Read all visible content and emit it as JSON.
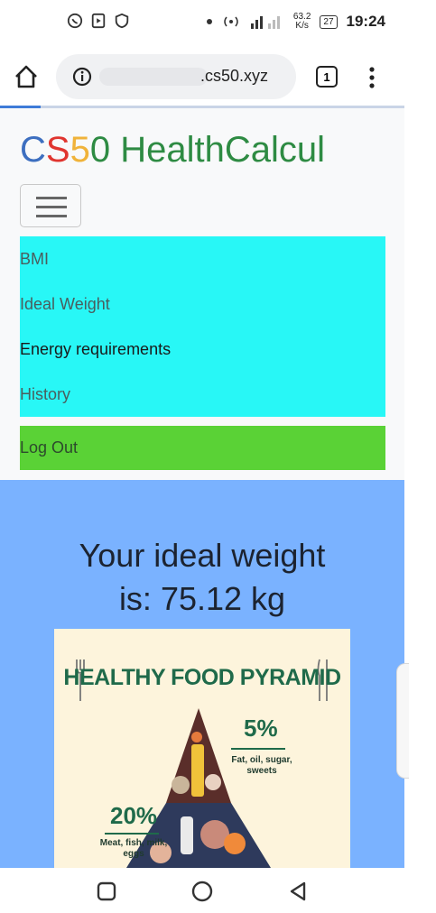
{
  "status_bar": {
    "network_speed_value": "63.2",
    "network_speed_unit": "K/s",
    "battery": "27",
    "clock": "19:24",
    "icons": [
      "whatsapp-icon",
      "media-icon",
      "shield-icon",
      "dot-icon",
      "hotspot-icon",
      "signal-icon",
      "battery-icon"
    ]
  },
  "browser": {
    "url_visible": ".cs50.xyz",
    "tab_count": "1",
    "icons": [
      "home-icon",
      "info-icon",
      "more-vert-icon"
    ]
  },
  "navbar": {
    "brand": {
      "letters": [
        {
          "text": "C",
          "color": "#3d6fc0"
        },
        {
          "text": "S",
          "color": "#e0352f"
        },
        {
          "text": "5",
          "color": "#f0b33a"
        },
        {
          "text": "0",
          "color": "#2e8b43"
        }
      ],
      "rest": " HealthCalcul",
      "rest_color": "#2e8b43"
    },
    "items": [
      {
        "label": "BMI",
        "active": false
      },
      {
        "label": "Ideal Weight",
        "active": false
      },
      {
        "label": "Energy requirements",
        "active": true
      },
      {
        "label": "History",
        "active": false
      }
    ],
    "logout_label": "Log Out",
    "colors": {
      "nav_bg": "#28f7f6",
      "logout_bg": "#5ad236",
      "content_bg": "#7ab2ff"
    }
  },
  "main": {
    "result_line1": "Your ideal weight",
    "result_line2": "is: 75.12 kg",
    "pyramid": {
      "title": "HEALTHY FOOD PYRAMID",
      "tiers": [
        {
          "percent": "5%",
          "label_line1": "Fat, oil, sugar,",
          "label_line2": "sweets"
        },
        {
          "percent": "20%",
          "label_line1": "Meat, fish, milk,",
          "label_line2": "eggs"
        }
      ]
    }
  },
  "system_nav": {
    "icons": [
      "recent-apps-icon",
      "home-circle-icon",
      "back-icon"
    ]
  }
}
